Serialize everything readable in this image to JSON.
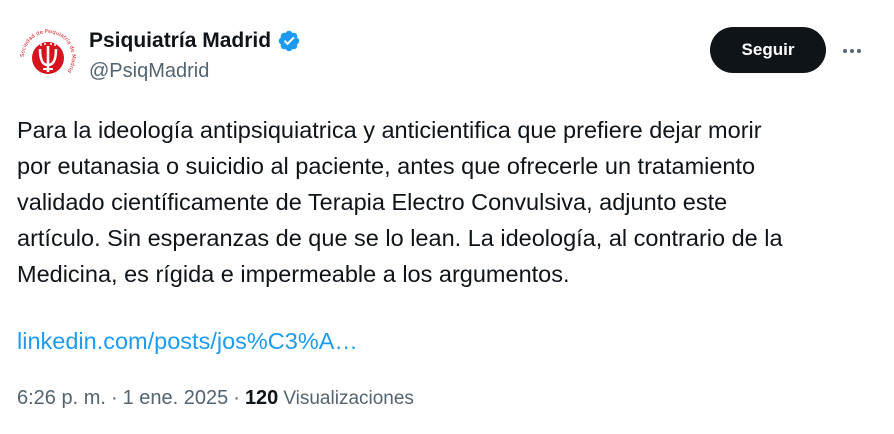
{
  "author": {
    "display_name": "Psiquiatría Madrid",
    "handle": "@PsiqMadrid",
    "avatar_ring_text": "Sociedad de Psiquiatría de Madrid",
    "verified_icon": "verified-badge-icon",
    "verified_color": "#1d9bf0"
  },
  "actions": {
    "follow_label": "Seguir",
    "more_icon": "more-options-icon"
  },
  "tweet": {
    "text": "Para la ideología antipsiquiatrica y anticientifica que prefiere dejar morir\npor eutanasia o suicidio al paciente, antes que ofrecerle un tratamiento\nvalidado científicamente de Terapia Electro Convulsiva, adjunto este\nartículo. Sin esperanzas de que se lo lean. La ideología, al contrario de la\nMedicina, es rígida e impermeable a los argumentos.",
    "link": "linkedin.com/posts/jos%C3%A…"
  },
  "meta": {
    "time": "6:26 p. m.",
    "separator": "·",
    "date": "1 ene. 2025",
    "views_count": "120",
    "views_label": "Visualizaciones"
  },
  "colors": {
    "text_primary": "#0f1419",
    "text_secondary": "#536471",
    "link": "#1d9bf0",
    "avatar_red": "#d7141e"
  }
}
